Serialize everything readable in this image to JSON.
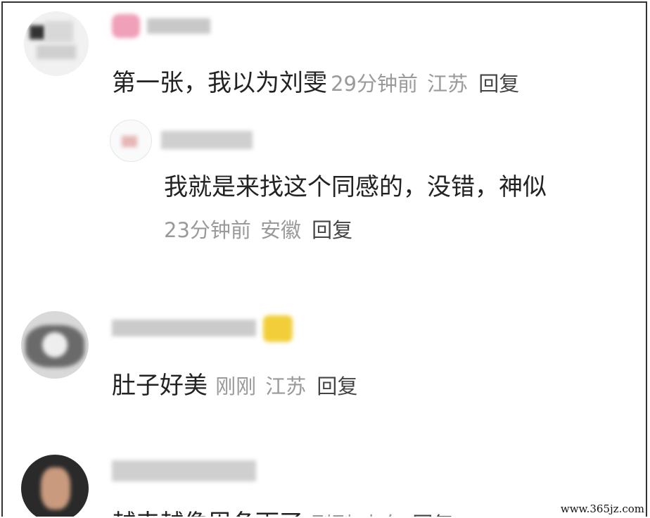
{
  "comments": [
    {
      "text": "第一张，我以为刘雯",
      "time": "29分钟前",
      "location": "江苏",
      "reply": "回复"
    },
    {
      "text": "我就是来找这个同感的，没错，神似",
      "time": "23分钟前",
      "location": "安徽",
      "reply": "回复"
    },
    {
      "text": "肚子好美",
      "time": "刚刚",
      "location": "江苏",
      "reply": "回复"
    },
    {
      "text": "越来越像周冬雨了",
      "time": "刚刚",
      "location": "山东",
      "reply": "回复"
    }
  ],
  "watermark": "www.365jz.com",
  "colors": {
    "text": "#222222",
    "meta": "#9a9a9a",
    "reply": "#444444",
    "background": "#ffffff",
    "border": "#333333"
  }
}
